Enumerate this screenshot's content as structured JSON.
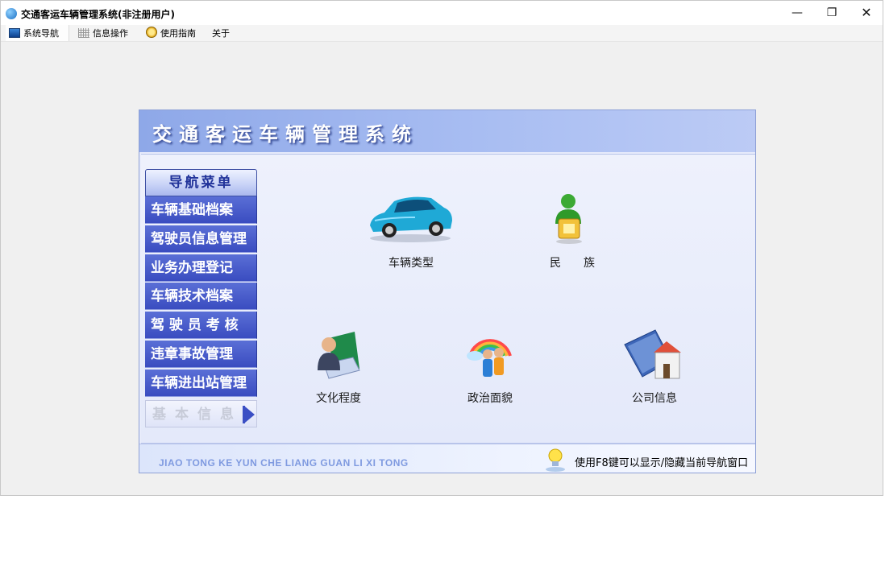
{
  "window": {
    "title": "交通客运车辆管理系统(非注册用户)",
    "controls": {
      "minimize": "—",
      "maximize": "❐",
      "close": "✕"
    }
  },
  "menu": [
    {
      "label": "系统导航",
      "icon": "monitor-icon"
    },
    {
      "label": "信息操作",
      "icon": "grid-icon"
    },
    {
      "label": "使用指南",
      "icon": "clock-icon"
    },
    {
      "label": "关于",
      "icon": ""
    }
  ],
  "header": {
    "title": "交通客运车辆管理系统"
  },
  "nav": {
    "heading": "导航菜单",
    "items": [
      "车辆基础档案",
      "驾驶员信息管理",
      "业务办理登记",
      "车辆技术档案",
      "驾 驶 员 考 核",
      "违章事故管理",
      "车辆进出站管理",
      "基本信息"
    ]
  },
  "features": [
    {
      "label": "车辆类型",
      "icon": "car-icon"
    },
    {
      "label": "民　　族",
      "icon": "ethnic-person-icon"
    },
    {
      "label": "文化程度",
      "icon": "education-icon"
    },
    {
      "label": "政治面貌",
      "icon": "politics-icon"
    },
    {
      "label": "公司信息",
      "icon": "company-icon"
    }
  ],
  "footer": {
    "pinyin": "JIAO TONG KE YUN CHE LIANG GUAN LI XI TONG",
    "hint": "使用F8键可以显示/隐藏当前导航窗口"
  },
  "colors": {
    "nav_blue": "#3a4cc0",
    "header_blue": "#8ea8e8",
    "panel_bg": "#e8ecfb"
  }
}
